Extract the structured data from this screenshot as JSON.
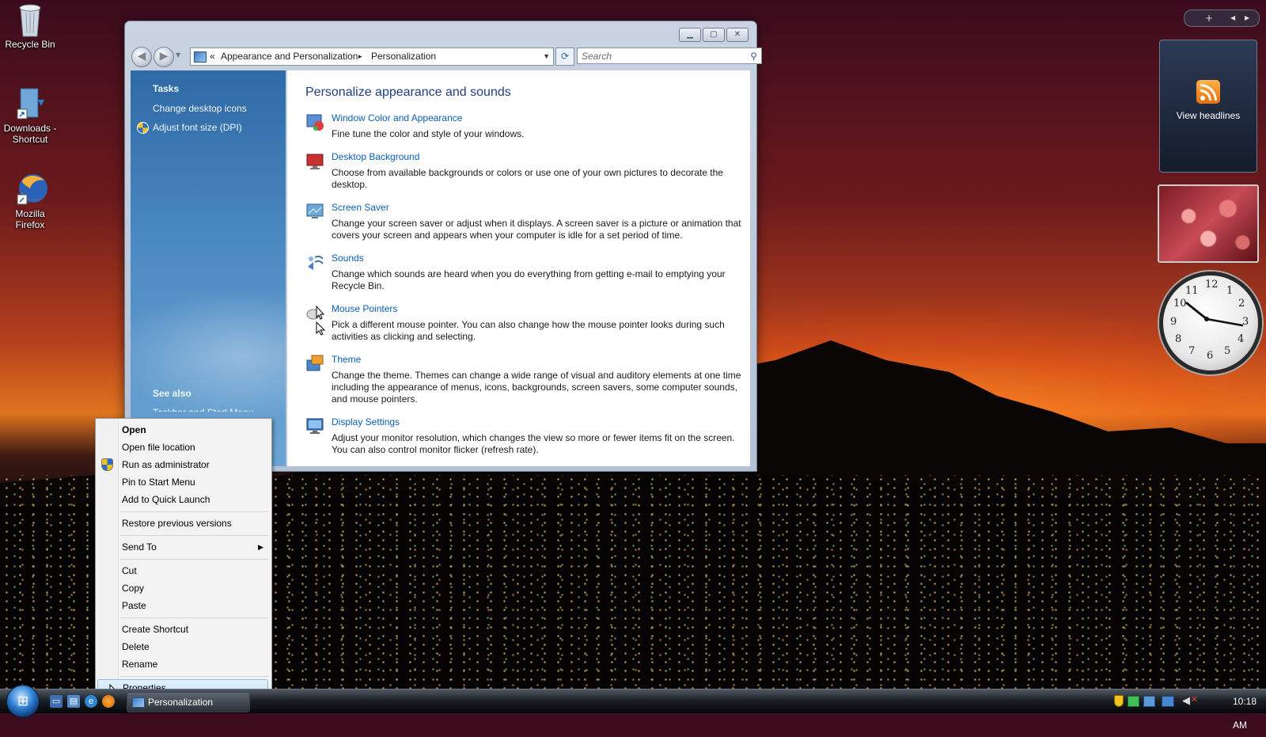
{
  "desktop": {
    "icons": [
      {
        "label": "Recycle Bin"
      },
      {
        "label": "Downloads - Shortcut"
      },
      {
        "label": "Mozilla Firefox"
      }
    ]
  },
  "window": {
    "breadcrumb": {
      "root_glyph": "«",
      "part1": "Appearance and Personalization",
      "sep": "▸",
      "part2": "Personalization"
    },
    "search_placeholder": "Search",
    "sidebar": {
      "tasks_header": "Tasks",
      "tasks": [
        "Change desktop icons",
        "Adjust font size (DPI)"
      ],
      "see_also_header": "See also",
      "see_also": [
        "Taskbar and Start Menu"
      ]
    },
    "heading": "Personalize appearance and sounds",
    "items": [
      {
        "title": "Window Color and Appearance",
        "desc": "Fine tune the color and style of your windows."
      },
      {
        "title": "Desktop Background",
        "desc": "Choose from available backgrounds or colors or use one of your own pictures to decorate the desktop."
      },
      {
        "title": "Screen Saver",
        "desc": "Change your screen saver or adjust when it displays. A screen saver is a picture or animation that covers your screen and appears when your computer is idle for a set period of time."
      },
      {
        "title": "Sounds",
        "desc": "Change which sounds are heard when you do everything from getting e-mail to emptying your Recycle Bin."
      },
      {
        "title": "Mouse Pointers",
        "desc": "Pick a different mouse pointer. You can also change how the mouse pointer looks during such activities as clicking and selecting."
      },
      {
        "title": "Theme",
        "desc": "Change the theme. Themes can change a wide range of visual and auditory elements at one time including the appearance of menus, icons, backgrounds, screen savers, some computer sounds, and mouse pointers."
      },
      {
        "title": "Display Settings",
        "desc": "Adjust your monitor resolution, which changes the view so more or fewer items fit on the screen. You can also control monitor flicker (refresh rate)."
      }
    ]
  },
  "context_menu": {
    "items": [
      {
        "label": "Open"
      },
      {
        "label": "Open file location"
      },
      {
        "label": "Run as administrator"
      },
      {
        "label": "Pin to Start Menu"
      },
      {
        "label": "Add to Quick Launch"
      },
      {
        "label": "Restore previous versions"
      },
      {
        "label": "Send To"
      },
      {
        "label": "Cut"
      },
      {
        "label": "Copy"
      },
      {
        "label": "Paste"
      },
      {
        "label": "Create Shortcut"
      },
      {
        "label": "Delete"
      },
      {
        "label": "Rename"
      },
      {
        "label": "Properties"
      }
    ]
  },
  "taskbar": {
    "active_window": "Personalization",
    "time": "10:18 AM"
  },
  "gadgets": {
    "feed_label": "View headlines",
    "clock_numbers": [
      "12",
      "1",
      "2",
      "3",
      "4",
      "5",
      "6",
      "7",
      "8",
      "9",
      "10",
      "11"
    ]
  },
  "colors": {
    "link": "#0b5fb5",
    "heading": "#1f3d80",
    "sidebar": "#4c8ac2"
  }
}
